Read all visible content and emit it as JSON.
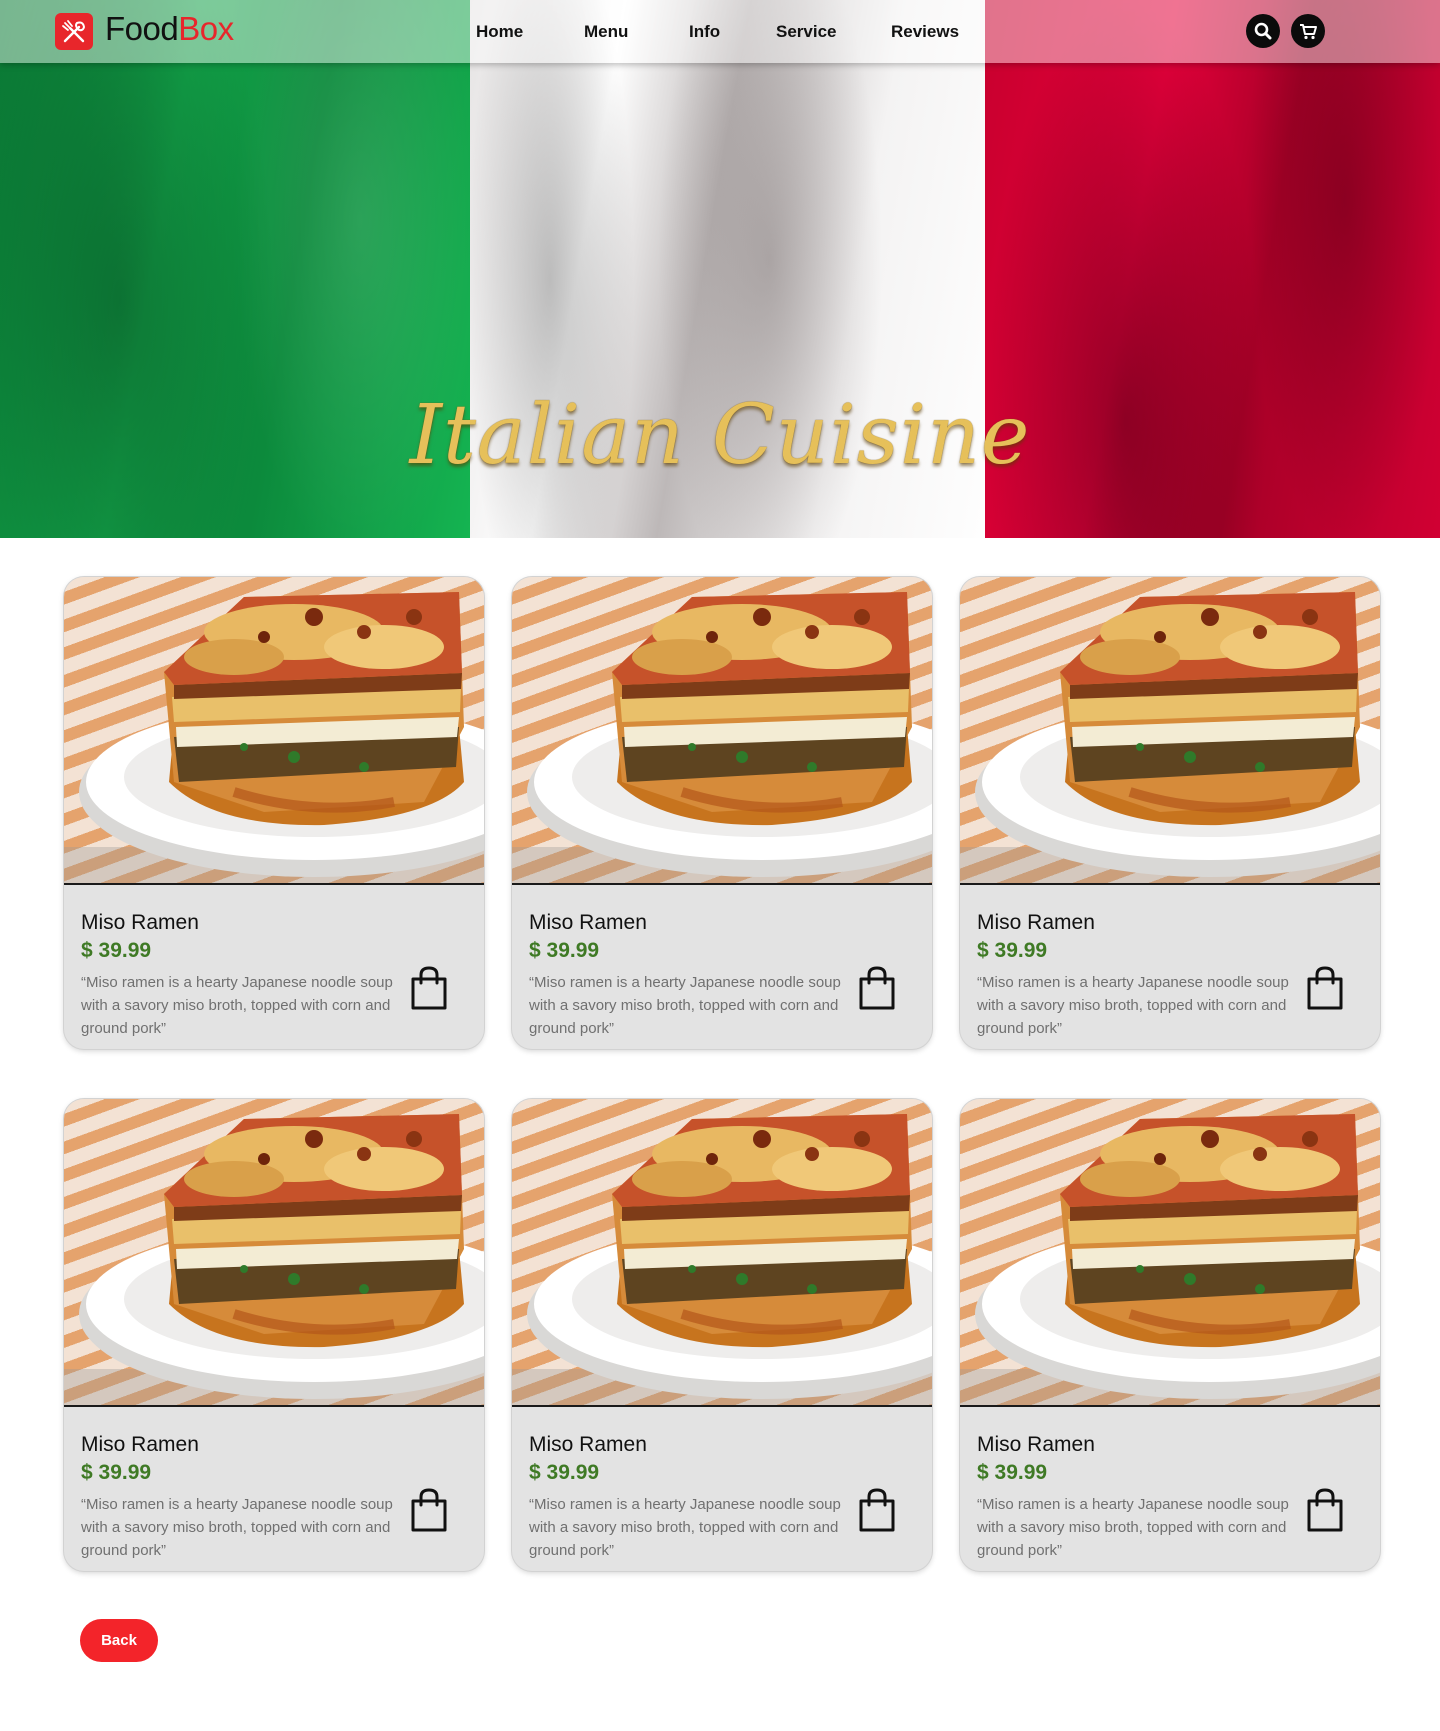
{
  "brand": {
    "name_part1": "Food",
    "name_part2": "Box",
    "accent": "#e8262b"
  },
  "nav": {
    "items": [
      {
        "label": "Home"
      },
      {
        "label": "Menu"
      },
      {
        "label": "Info"
      },
      {
        "label": "Service"
      },
      {
        "label": "Reviews"
      }
    ],
    "icons": [
      "search-icon",
      "cart-icon"
    ]
  },
  "hero": {
    "title": "Italian Cuisine",
    "flag_colors": [
      "#12a449",
      "#ffffff",
      "#e3003a"
    ],
    "title_color": "#e6c05a"
  },
  "products": [
    {
      "name": "Miso Ramen",
      "price": "$ 39.99",
      "description": "“Miso ramen is a hearty Japanese noodle soup with a savory miso broth, topped with corn and ground pork”",
      "icon": "shopping-bag-icon"
    },
    {
      "name": "Miso Ramen",
      "price": "$ 39.99",
      "description": "“Miso ramen is a hearty Japanese noodle soup with a savory miso broth, topped with corn and ground pork”",
      "icon": "shopping-bag-icon"
    },
    {
      "name": "Miso Ramen",
      "price": "$ 39.99",
      "description": "“Miso ramen is a hearty Japanese noodle soup with a savory miso broth, topped with corn and ground pork”",
      "icon": "shopping-bag-icon"
    },
    {
      "name": "Miso Ramen",
      "price": "$ 39.99",
      "description": "“Miso ramen is a hearty Japanese noodle soup with a savory miso broth, topped with corn and ground pork”",
      "icon": "shopping-bag-icon"
    },
    {
      "name": "Miso Ramen",
      "price": "$ 39.99",
      "description": "“Miso ramen is a hearty Japanese noodle soup with a savory miso broth, topped with corn and ground pork”",
      "icon": "shopping-bag-icon"
    },
    {
      "name": "Miso Ramen",
      "price": "$ 39.99",
      "description": "“Miso ramen is a hearty Japanese noodle soup with a savory miso broth, topped with corn and ground pork”",
      "icon": "shopping-bag-icon"
    }
  ],
  "colors": {
    "price": "#3f7a25",
    "card_bg": "#e3e3e3",
    "back_button": "#f3242a"
  },
  "back_button": {
    "label": "Back"
  }
}
